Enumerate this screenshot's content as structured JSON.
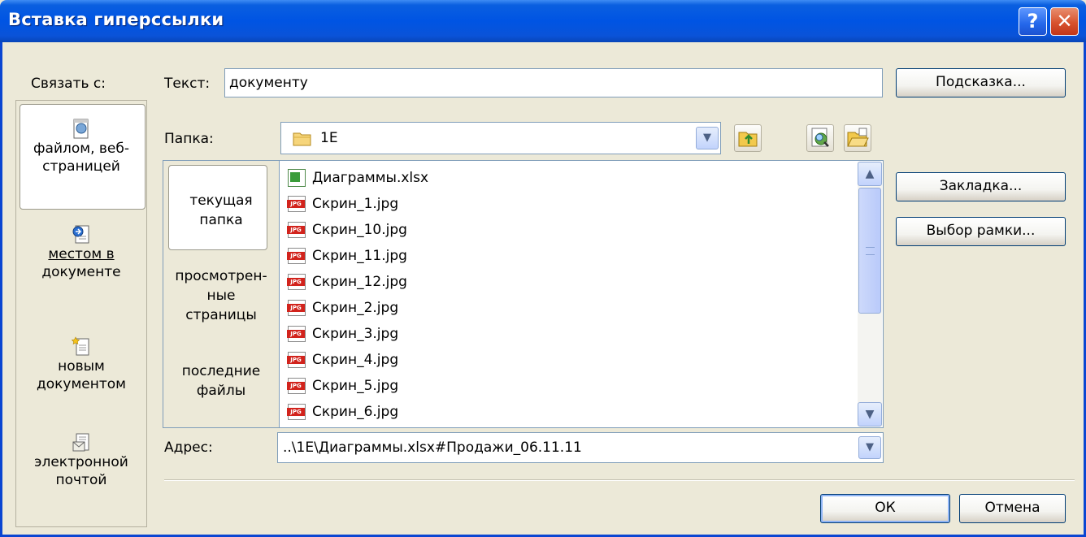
{
  "dialog": {
    "title": "Вставка гиперссылки",
    "help_glyph": "?",
    "close_glyph": "✕"
  },
  "link_to": {
    "label": "Связать с:",
    "items": [
      {
        "line1": "файлом, веб-",
        "line2": "страницей",
        "icon": "web-page-icon",
        "selected": true
      },
      {
        "line1": "местом в",
        "line2": "документе",
        "icon": "place-in-document-icon",
        "selected": false
      },
      {
        "line1": "новым",
        "line2": "документом",
        "icon": "new-document-icon",
        "selected": false
      },
      {
        "line1": "электронной",
        "line2": "почтой",
        "icon": "email-icon",
        "selected": false
      }
    ]
  },
  "text_field": {
    "label": "Текст:",
    "value": "документу"
  },
  "hint_button": "Подсказка...",
  "folder": {
    "label": "Папка:",
    "value": "1E"
  },
  "browse_tabs": [
    {
      "line1": "текущая",
      "line2": "папка",
      "selected": true
    },
    {
      "line1": "просмотрен-",
      "line2": "ные",
      "line3": "страницы",
      "selected": false
    },
    {
      "line1": "последние",
      "line2": "файлы",
      "selected": false
    }
  ],
  "files": [
    {
      "name": "Диаграммы.xlsx",
      "type": "xlsx"
    },
    {
      "name": "Скрин_1.jpg",
      "type": "jpg"
    },
    {
      "name": "Скрин_10.jpg",
      "type": "jpg"
    },
    {
      "name": "Скрин_11.jpg",
      "type": "jpg"
    },
    {
      "name": "Скрин_12.jpg",
      "type": "jpg"
    },
    {
      "name": "Скрин_2.jpg",
      "type": "jpg"
    },
    {
      "name": "Скрин_3.jpg",
      "type": "jpg"
    },
    {
      "name": "Скрин_4.jpg",
      "type": "jpg"
    },
    {
      "name": "Скрин_5.jpg",
      "type": "jpg"
    },
    {
      "name": "Скрин_6.jpg",
      "type": "jpg"
    }
  ],
  "jpg_badge": "JPG",
  "bookmark_button": "Закладка...",
  "frame_button": "Выбор рамки...",
  "address": {
    "label": "Адрес:",
    "value": "..\\1E\\Диаграммы.xlsx#Продажи_06.11.11"
  },
  "ok_button": "ОК",
  "cancel_button": "Отмена",
  "colors": {
    "titlebar": "#0054e3",
    "dialog_bg": "#ece9d8",
    "close": "#d8532e"
  }
}
